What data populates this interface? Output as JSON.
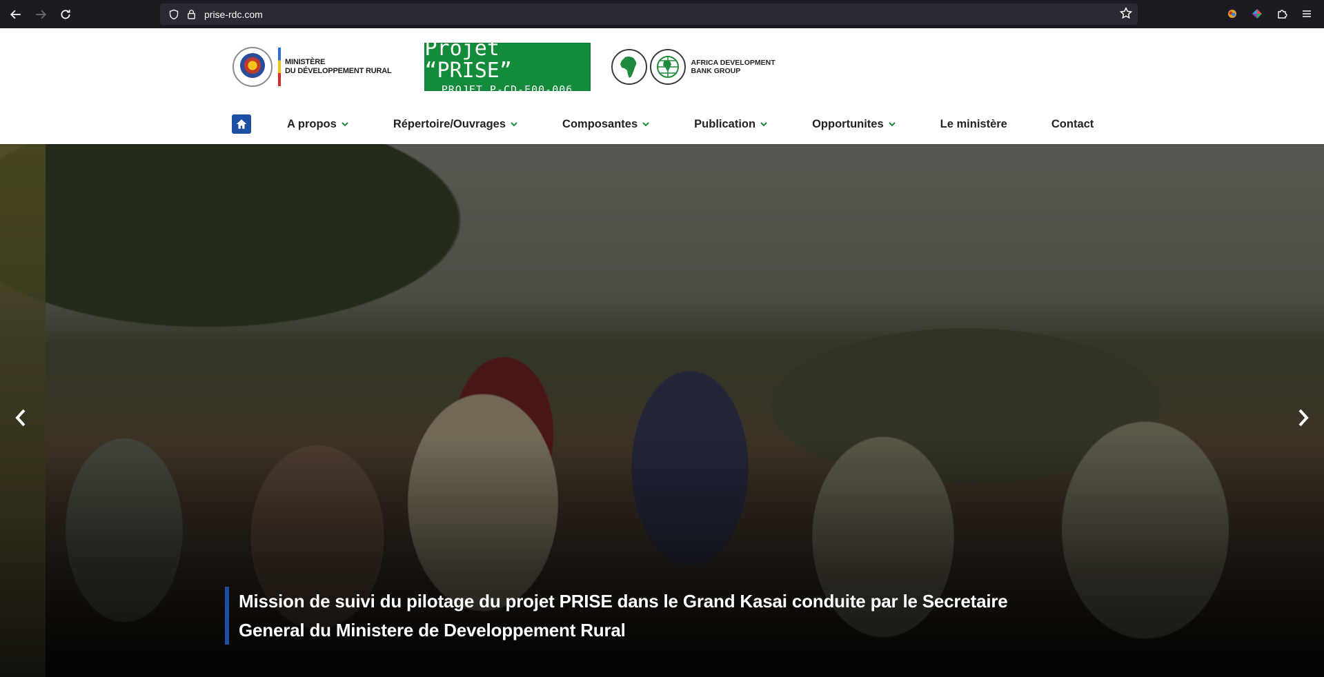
{
  "browser": {
    "url": "prise-rdc.com"
  },
  "header": {
    "ministry_line1": "MINISTÈRE",
    "ministry_line2": "DU DÉVELOPPEMENT RURAL",
    "prise_title": "Projet “PRISE”",
    "prise_subtitle": "PROJET P-CD-E00-006",
    "afdb_line1": "AFRICA DEVELOPMENT",
    "afdb_line2": "BANK GROUP"
  },
  "nav": {
    "items": [
      {
        "label": "A propos",
        "dropdown": true
      },
      {
        "label": "Répertoire/Ouvrages",
        "dropdown": true
      },
      {
        "label": "Composantes",
        "dropdown": true
      },
      {
        "label": "Publication",
        "dropdown": true
      },
      {
        "label": "Opportunites",
        "dropdown": true
      },
      {
        "label": "Le ministère",
        "dropdown": false
      },
      {
        "label": "Contact",
        "dropdown": false
      }
    ]
  },
  "hero": {
    "caption_line1": "Mission de suivi du pilotage du projet PRISE dans le Grand Kasai conduite par le Secretaire",
    "caption_line2": "General du Ministere de Developpement Rural"
  },
  "colors": {
    "accent_blue": "#1d4fa3",
    "prise_green": "#128b3b",
    "chevron_green": "#1e8a3a"
  }
}
